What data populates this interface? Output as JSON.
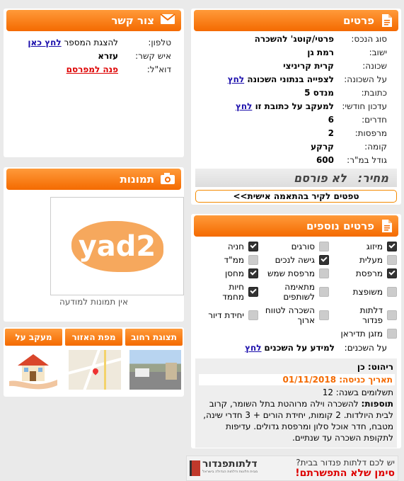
{
  "details": {
    "title": "פרטים",
    "rows": [
      {
        "label": "סוג הנכס:",
        "value": "פרטי/קוטג' להשכרה"
      },
      {
        "label": "ישוב:",
        "value": "רמת גן"
      },
      {
        "label": "שכונה:",
        "value": "קרית קריניצי"
      },
      {
        "label": "על השכונה:",
        "value": "לצפייה בנתוני השכונה",
        "link": "לחץ"
      },
      {
        "label": "כתובת:",
        "value": "מנדס 5"
      },
      {
        "label": "עדכון חודשי:",
        "value": "למעקב על כתובת זו",
        "link": "לחץ"
      },
      {
        "label": "חדרים:",
        "value": "6"
      },
      {
        "label": "מרפסות:",
        "value": "2"
      },
      {
        "label": "קומה:",
        "value": "קרקע"
      },
      {
        "label": "גודל במ\"ר:",
        "value": "600"
      }
    ],
    "price_label": "מחיר:",
    "price_value": "לא פורסם",
    "tips": "טפטים לקיר בהתאמה אישית>>"
  },
  "features": {
    "title": "פרטים נוספים",
    "items": [
      {
        "label": "מיזוג",
        "checked": true
      },
      {
        "label": "סורגים",
        "checked": false
      },
      {
        "label": "חניה",
        "checked": true
      },
      {
        "label": "מעלית",
        "checked": false
      },
      {
        "label": "גישה לנכים",
        "checked": true
      },
      {
        "label": "ממ\"ד",
        "checked": false
      },
      {
        "label": "מרפסת",
        "checked": true
      },
      {
        "label": "מרפסת שמש",
        "checked": false
      },
      {
        "label": "מחסן",
        "checked": true
      },
      {
        "label": "משופצת",
        "checked": false
      },
      {
        "label": "מתאימה לשותפים",
        "checked": false
      },
      {
        "label": "חיות מחמד",
        "checked": true
      },
      {
        "label": "דלתות פנדור",
        "checked": false
      },
      {
        "label": "השכרה לטווח ארוך",
        "checked": false
      },
      {
        "label": "יחידת דיור",
        "checked": false
      },
      {
        "label": "מזגן תדיראן",
        "checked": false
      }
    ],
    "neighbors_label": "על השכנים:",
    "neighbors_value": "למידע על השכנים",
    "neighbors_link": "לחץ",
    "furniture": "ריהוט: כן",
    "entry_date": "תאריך כניסה: 01/11/2018",
    "payments": "תשלומים בשנה: 12",
    "additions_label": "תוספות:",
    "additions_text": "להשכרה וילה מרוהטת בתל השומר, קרוב לבית היולדות. 2 קומות, יחידת הורים + 3 חדרי שינה, מטבח, חדר אוכל סלון ומרפסת גדולים. עדיפות לתקופת השכרה עד שנתיים."
  },
  "contact": {
    "title": "צור קשר",
    "phone_label": "טלפון:",
    "phone_text": "להצגת המספר",
    "phone_link": "לחץ כאן",
    "person_label": "איש קשר:",
    "person_value": "עזרא",
    "email_label": "דוא\"ל:",
    "email_link": "פנה למפרסם"
  },
  "photos": {
    "title": "תמונות",
    "logo": "yad2",
    "no_images": "אין תמונות למודעה"
  },
  "map_buttons": [
    "תצוגת רחוב",
    "מפת האזור",
    "מעקב על הנכס"
  ],
  "ad": {
    "line1": "יש לכם דלתות פנדור בבית?",
    "line2": "סימן שלא התפשרתם!",
    "brand": "דלתותפנדור",
    "brand_sub": "מבית חלונות ודלתות הגדולה בישראל"
  },
  "colors": {
    "accent": "#f46a00",
    "link": "#1a0dab",
    "alert": "#dd0000"
  }
}
